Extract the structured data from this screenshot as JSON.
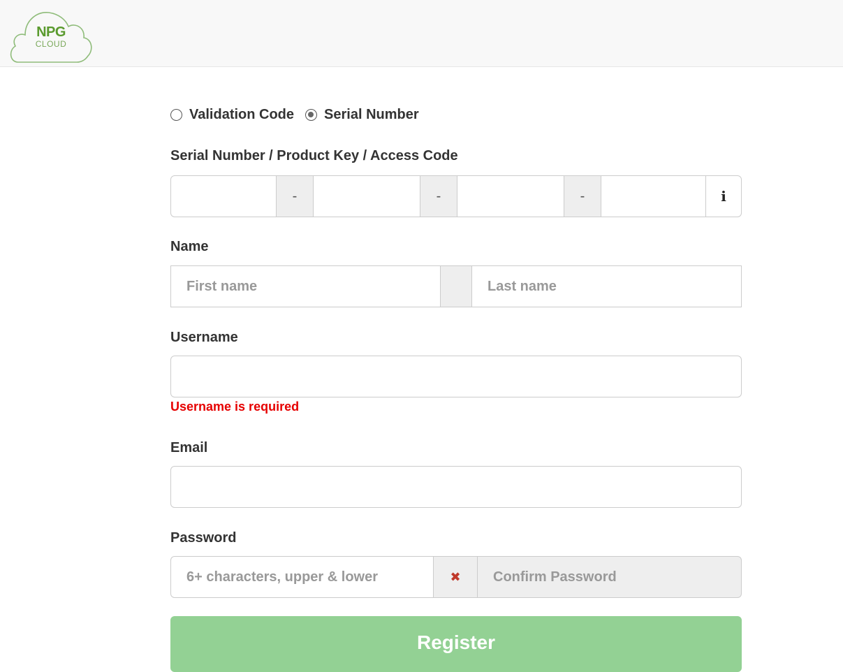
{
  "brand": {
    "logo_main": "NPG",
    "logo_sub": "CLOUD",
    "color": "#5a9a2e"
  },
  "mode_selector": {
    "options": [
      {
        "label": "Validation Code",
        "checked": false
      },
      {
        "label": "Serial Number",
        "checked": true
      }
    ]
  },
  "serial": {
    "label": "Serial Number / Product Key / Access Code",
    "segments": [
      "",
      "",
      "",
      ""
    ],
    "separator": "-",
    "info_icon": "i"
  },
  "name": {
    "label": "Name",
    "first_placeholder": "First name",
    "last_placeholder": "Last name"
  },
  "username": {
    "label": "Username",
    "value": "",
    "error": "Username is required"
  },
  "email": {
    "label": "Email",
    "value": ""
  },
  "password": {
    "label": "Password",
    "placeholder": "6+ characters, upper & lower",
    "mismatch_icon": "✖",
    "confirm_placeholder": "Confirm Password"
  },
  "submit": {
    "label": "Register",
    "color": "#93d194"
  },
  "colors": {
    "error": "#e60000",
    "mismatch_icon": "#c0392b"
  }
}
